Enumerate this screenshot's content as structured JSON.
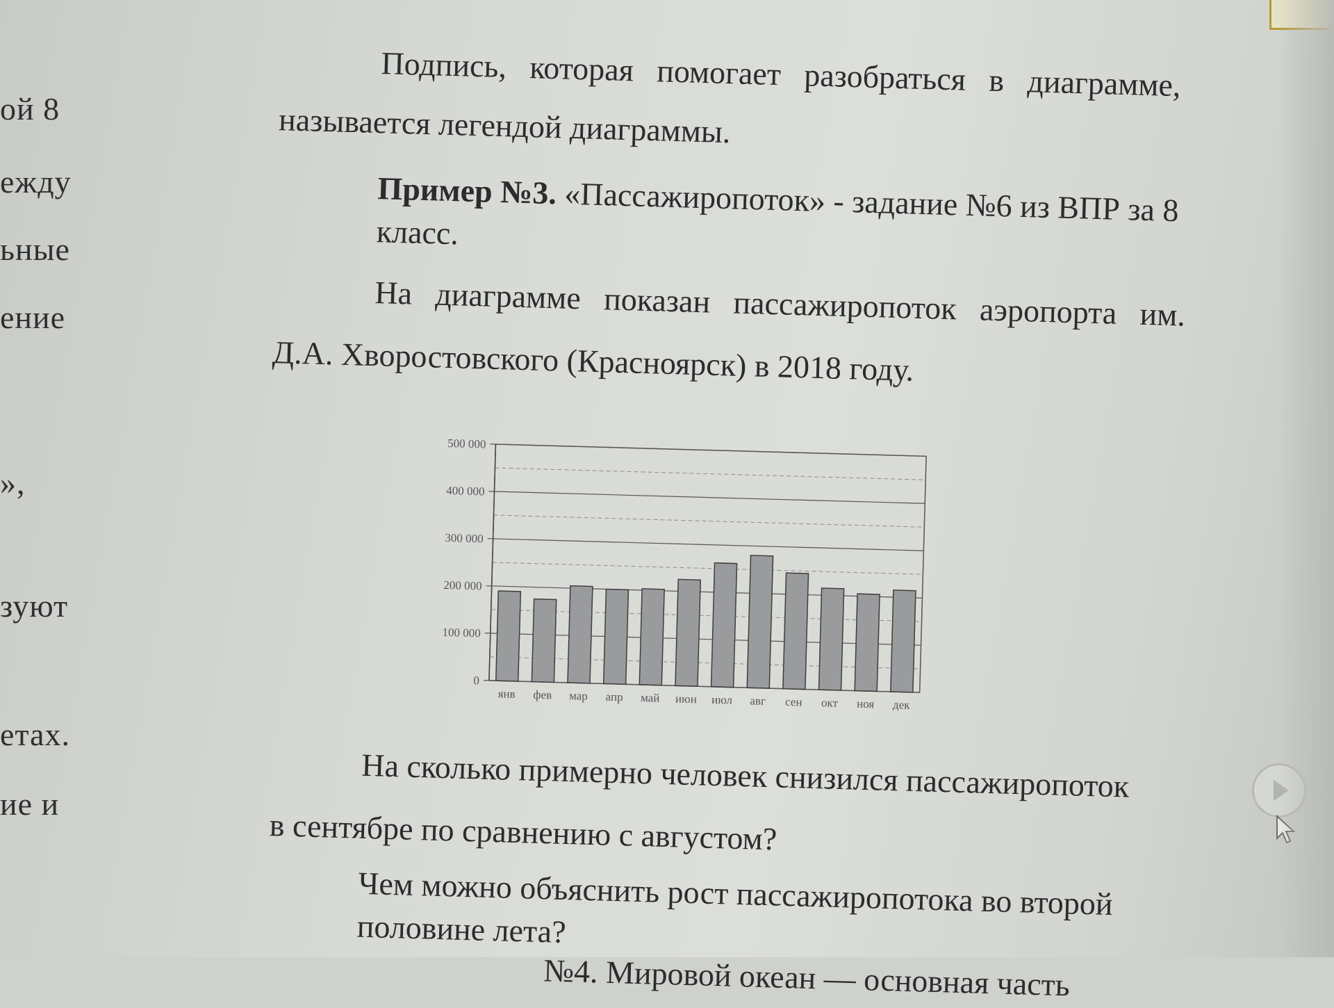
{
  "left_column": [
    "ой 8",
    "ежду",
    "ьные",
    "ение",
    "»,",
    "зуют",
    "етах.",
    "ие   и"
  ],
  "text": {
    "line1": "Подпись,  которая  помогает  разобраться  в  диаграмме,",
    "line2": "называется легендой диаграммы.",
    "example_label": "Пример №3.",
    "example_rest": " «Пассажиропоток» - задание №6 из ВПР за 8",
    "example_rest2": "класс.",
    "desc1": "На  диаграмме  показан  пассажиропоток  аэропорта  им.",
    "desc2": "Д.А. Хворостовского (Красноярск) в 2018 году.",
    "question1a": "На сколько примерно человек снизился пассажиропоток",
    "question1b": "в сентябре по сравнению с августом?",
    "question2a": "Чем можно объяснить рост пассажиропотока во второй",
    "question2b": "половине лета?",
    "next_line": "№4.  Мировой   океан   —   основная   часть"
  },
  "chart_data": {
    "type": "bar",
    "categories": [
      "янв",
      "фев",
      "мар",
      "апр",
      "май",
      "июн",
      "июл",
      "авг",
      "сен",
      "окт",
      "ноя",
      "дек"
    ],
    "values": [
      190000,
      175000,
      205000,
      200000,
      203000,
      225000,
      262000,
      280000,
      245000,
      215000,
      205000,
      215000
    ],
    "ylim": [
      0,
      500000
    ],
    "yticks": [
      "0",
      "100 000",
      "200 000",
      "300 000",
      "400 000",
      "500 000"
    ],
    "ytick_values": [
      0,
      100000,
      200000,
      300000,
      400000,
      500000
    ],
    "grid": true,
    "bar_color": "#9a9b9d"
  }
}
